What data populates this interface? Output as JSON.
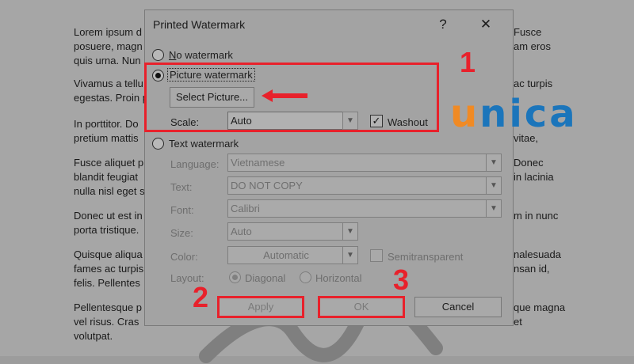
{
  "document": {
    "left_lines": [
      "Lorem ipsum d",
      "posuere, magn",
      "quis urna. Nun",
      "Vivamus a tellu",
      "egestas. Proin p",
      "In porttitor. Do",
      "pretium mattis",
      "Fusce aliquet p",
      "blandit feugiat",
      "nulla nisl eget s",
      "Donec ut est in",
      "porta tristique.",
      "Quisque aliqua",
      "fames ac turpis",
      "felis. Pellentes",
      "Pellentesque p",
      "vel risus. Cras",
      "volutpat."
    ],
    "right_lines": [
      "Fusce",
      "am eros",
      "",
      "ac turpis",
      "",
      "",
      "vitae,",
      "Donec",
      "in lacinia",
      "",
      "m in nunc",
      "",
      "nalesuada",
      "nsan id,",
      "",
      "que magna",
      "et",
      ""
    ]
  },
  "dialog": {
    "title": "Printed Watermark",
    "help_glyph": "?",
    "close_glyph": "✕",
    "no_watermark_label": "No watermark",
    "picture_watermark_label": "Picture watermark",
    "select_picture_label": "Select Picture...",
    "scale_label": "Scale:",
    "scale_value": "Auto",
    "washout_label": "Washout",
    "washout_checked": true,
    "text_watermark_label": "Text watermark",
    "language_label": "Language:",
    "language_value": "Vietnamese",
    "text_label": "Text:",
    "text_value": "DO NOT COPY",
    "font_label": "Font:",
    "font_value": "Calibri",
    "size_label": "Size:",
    "size_value": "Auto",
    "color_label": "Color:",
    "color_value": "Automatic",
    "semitransparent_label": "Semitransparent",
    "layout_label": "Layout:",
    "diagonal_label": "Diagonal",
    "horizontal_label": "Horizontal",
    "apply_label": "Apply",
    "ok_label": "OK",
    "cancel_label": "Cancel"
  },
  "annotations": {
    "step1": "1",
    "step2": "2",
    "step3": "3",
    "highlight_color": "#e8212b"
  },
  "logo": {
    "text_u": "u",
    "text_n": "n",
    "text_i": "i",
    "text_c": "c",
    "text_a": "a",
    "orange": "#f08a24",
    "blue": "#1b75bb"
  }
}
